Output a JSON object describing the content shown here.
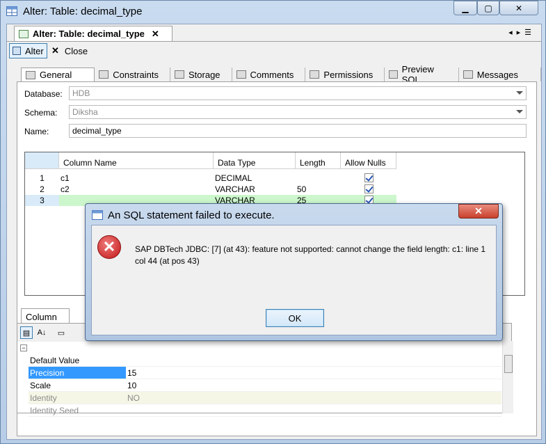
{
  "window": {
    "title": "Alter: Table: decimal_type"
  },
  "doc_tab": {
    "label": "Alter: Table: decimal_type",
    "close": "✕"
  },
  "toolbar": {
    "alter": "Alter",
    "close": "Close"
  },
  "tabs": [
    {
      "label": "General"
    },
    {
      "label": "Constraints"
    },
    {
      "label": "Storage"
    },
    {
      "label": "Comments"
    },
    {
      "label": "Permissions"
    },
    {
      "label": "Preview SQL"
    },
    {
      "label": "Messages"
    }
  ],
  "form": {
    "database_label": "Database:",
    "database_value": "HDB",
    "schema_label": "Schema:",
    "schema_value": "Diksha",
    "name_label": "Name:",
    "name_value": "decimal_type"
  },
  "grid": {
    "headers": [
      "Column Name",
      "Data Type",
      "Length",
      "Allow Nulls"
    ],
    "rows": [
      {
        "num": "1",
        "name": "c1",
        "type": "DECIMAL",
        "length": "",
        "nulls": true
      },
      {
        "num": "2",
        "name": "c2",
        "type": "VARCHAR",
        "length": "50",
        "nulls": true
      },
      {
        "num": "3",
        "name": "",
        "type": "VARCHAR",
        "length": "25",
        "nulls": true
      }
    ]
  },
  "column_panel": {
    "tab": "Column",
    "props": [
      {
        "key": "Default Value",
        "value": ""
      },
      {
        "key": "Precision",
        "value": "15"
      },
      {
        "key": "Scale",
        "value": "10"
      },
      {
        "key": "Identity",
        "value": "NO"
      },
      {
        "key": "Identity Seed",
        "value": ""
      }
    ]
  },
  "dialog": {
    "title": "An SQL statement failed to execute.",
    "message": "SAP DBTech JDBC: [7] (at 43): feature not supported: cannot change the field length: c1: line 1 col 44 (at pos 43)",
    "ok": "OK"
  },
  "colors": {
    "selected_prop": "#3399ff",
    "new_row": "#ccf7cc",
    "identity_row": "#f6f6e6"
  }
}
